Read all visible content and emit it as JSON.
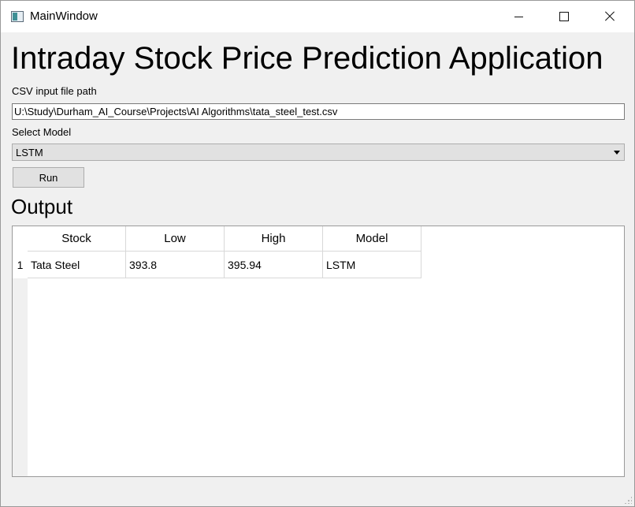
{
  "window": {
    "title": "MainWindow"
  },
  "heading": "Intraday Stock Price Prediction Application",
  "csv": {
    "label": "CSV input file path",
    "value": "U:\\Study\\Durham_AI_Course\\Projects\\AI Algorithms\\tata_steel_test.csv"
  },
  "model": {
    "label": "Select Model",
    "selected": "LSTM"
  },
  "run_label": "Run",
  "output": {
    "title": "Output",
    "columns": [
      "Stock",
      "Low",
      "High",
      "Model"
    ],
    "rows": [
      {
        "number": "1",
        "cells": [
          "Tata Steel",
          "393.8",
          "395.94",
          "LSTM"
        ]
      }
    ]
  }
}
